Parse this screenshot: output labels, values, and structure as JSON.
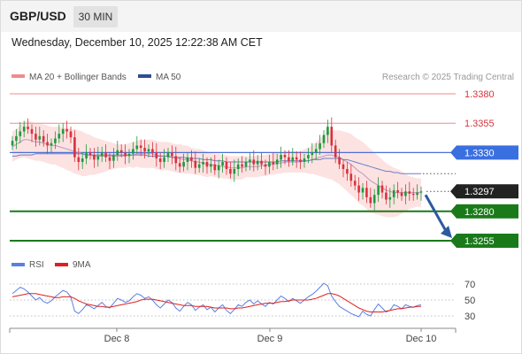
{
  "header": {
    "symbol": "GBP/USD",
    "timeframe": "30 MIN",
    "datetime": "Wednesday, December 10, 2025 12:22:38 AM CET"
  },
  "legend": {
    "ma20_label": "MA 20 + Bollinger Bands",
    "ma50_label": "MA 50",
    "source": "Research © 2025 Trading Central"
  },
  "colors": {
    "up": "#1e9a3c",
    "down": "#d8323c",
    "resistance": "#f08b8b",
    "support": "#1a7a1a",
    "ma50": "#4a6fd6",
    "ma20": "#c9a0c0",
    "band_fill": "#fde2e2",
    "arrow": "#2c5aa0",
    "rsi": "#5b7fe0",
    "rsi_ma": "#e02020"
  },
  "chart_data": [
    {
      "type": "candlestick",
      "levels": [
        {
          "value": "1.3380",
          "kind": "resistance"
        },
        {
          "value": "1.3355",
          "kind": "resistance"
        },
        {
          "value": "1.3330",
          "kind": "pivot"
        },
        {
          "value": "1.3297",
          "kind": "last"
        },
        {
          "value": "1.3280",
          "kind": "support"
        },
        {
          "value": "1.3255",
          "kind": "support"
        }
      ],
      "ylim": [
        1.3245,
        1.3392
      ],
      "xlabels": [
        "Dec 8",
        "Dec 9",
        "Dec 10"
      ],
      "series": [
        {
          "name": "MA 20 + Bollinger Bands"
        },
        {
          "name": "MA 50"
        }
      ],
      "close": [
        1.334,
        1.3344,
        1.3348,
        1.3352,
        1.335,
        1.3346,
        1.3341,
        1.3344,
        1.3339,
        1.3336,
        1.3338,
        1.3342,
        1.3346,
        1.335,
        1.3348,
        1.3343,
        1.3326,
        1.3322,
        1.3325,
        1.333,
        1.3328,
        1.3324,
        1.3327,
        1.333,
        1.3326,
        1.3323,
        1.3328,
        1.3332,
        1.333,
        1.3327,
        1.3329,
        1.3333,
        1.3336,
        1.3334,
        1.3331,
        1.3333,
        1.333,
        1.3325,
        1.3322,
        1.3326,
        1.333,
        1.3327,
        1.3321,
        1.3318,
        1.3322,
        1.3326,
        1.3323,
        1.3317,
        1.332,
        1.3322,
        1.3318,
        1.332,
        1.3315,
        1.3319,
        1.3322,
        1.3316,
        1.3312,
        1.3316,
        1.332,
        1.3318,
        1.3322,
        1.3324,
        1.332,
        1.3323,
        1.332,
        1.3318,
        1.3322,
        1.332,
        1.3324,
        1.3328,
        1.3326,
        1.3323,
        1.3326,
        1.3324,
        1.3322,
        1.3325,
        1.3328,
        1.333,
        1.3333,
        1.3338,
        1.3345,
        1.3352,
        1.3336,
        1.3326,
        1.332,
        1.3316,
        1.3312,
        1.3306,
        1.3302,
        1.3296,
        1.33,
        1.3292,
        1.3287,
        1.3294,
        1.3302,
        1.3296,
        1.329,
        1.3292,
        1.3298,
        1.3296,
        1.3293,
        1.3297,
        1.3295,
        1.3294,
        1.3296,
        1.3297
      ],
      "ma20": [
        1.3335,
        1.3337,
        1.3339,
        1.3341,
        1.3341,
        1.334,
        1.3339,
        1.3339,
        1.3338,
        1.3337,
        1.3336,
        1.3336,
        1.3335,
        1.3334,
        1.3333,
        1.3332,
        1.3331,
        1.333,
        1.3329,
        1.3328,
        1.3328,
        1.3327,
        1.3327,
        1.3327,
        1.3327,
        1.3327,
        1.3327,
        1.3327,
        1.3327,
        1.3327,
        1.3328,
        1.3328,
        1.3329,
        1.3329,
        1.3329,
        1.3329,
        1.3329,
        1.3328,
        1.3327,
        1.3327,
        1.3327,
        1.3326,
        1.3325,
        1.3325,
        1.3324,
        1.3324,
        1.3323,
        1.3322,
        1.3322,
        1.3321,
        1.332,
        1.332,
        1.3319,
        1.3319,
        1.3318,
        1.3318,
        1.3317,
        1.3317,
        1.3317,
        1.3317,
        1.3318,
        1.3318,
        1.3318,
        1.3318,
        1.3319,
        1.3319,
        1.332,
        1.332,
        1.3321,
        1.3321,
        1.3322,
        1.3322,
        1.3322,
        1.3322,
        1.3322,
        1.3323,
        1.3323,
        1.3324,
        1.3325,
        1.3326,
        1.3327,
        1.3328,
        1.3328,
        1.3327,
        1.3326,
        1.3324,
        1.3322,
        1.332,
        1.3317,
        1.3314,
        1.3312,
        1.3309,
        1.3306,
        1.3304,
        1.3302,
        1.33,
        1.3298,
        1.3297,
        1.3296,
        1.3296,
        1.3296,
        1.3296,
        1.3296,
        1.3296,
        1.3296,
        1.3296
      ],
      "ma50": [
        1.3327,
        1.3327,
        1.3328,
        1.3328,
        1.3328,
        1.3328,
        1.3329,
        1.3329,
        1.3329,
        1.3329,
        1.3329,
        1.3329,
        1.3329,
        1.3329,
        1.3329,
        1.3329,
        1.3329,
        1.3329,
        1.3329,
        1.3328,
        1.3328,
        1.3328,
        1.3328,
        1.3328,
        1.3328,
        1.3328,
        1.3328,
        1.3328,
        1.3328,
        1.3328,
        1.3328,
        1.3328,
        1.3328,
        1.3328,
        1.3328,
        1.3327,
        1.3327,
        1.3327,
        1.3327,
        1.3327,
        1.3327,
        1.3326,
        1.3326,
        1.3326,
        1.3326,
        1.3325,
        1.3325,
        1.3325,
        1.3325,
        1.3324,
        1.3324,
        1.3324,
        1.3323,
        1.3323,
        1.3323,
        1.3322,
        1.3322,
        1.3322,
        1.3322,
        1.3322,
        1.3322,
        1.3322,
        1.3322,
        1.3322,
        1.3322,
        1.3322,
        1.3322,
        1.3322,
        1.3322,
        1.3323,
        1.3323,
        1.3323,
        1.3323,
        1.3323,
        1.3323,
        1.3323,
        1.3323,
        1.3324,
        1.3324,
        1.3324,
        1.3325,
        1.3325,
        1.3325,
        1.3325,
        1.3325,
        1.3324,
        1.3324,
        1.3323,
        1.3322,
        1.3321,
        1.332,
        1.3319,
        1.3318,
        1.3317,
        1.3316,
        1.3315,
        1.3314,
        1.3314,
        1.3313,
        1.3313,
        1.3312,
        1.3312,
        1.3312,
        1.3312,
        1.3312,
        1.3312
      ],
      "band_width": [
        0.0013,
        0.0013,
        0.0014,
        0.0015,
        0.0016,
        0.0016,
        0.0016,
        0.0016,
        0.0016,
        0.0016,
        0.0016,
        0.0016,
        0.0017,
        0.0017,
        0.0018,
        0.0018,
        0.0019,
        0.0019,
        0.0019,
        0.0018,
        0.0017,
        0.0016,
        0.0015,
        0.0014,
        0.0013,
        0.0012,
        0.0011,
        0.001,
        0.001,
        0.001,
        0.001,
        0.0011,
        0.0011,
        0.0012,
        0.0012,
        0.0012,
        0.0012,
        0.0012,
        0.0012,
        0.0012,
        0.0012,
        0.0012,
        0.0012,
        0.0012,
        0.0012,
        0.0012,
        0.0011,
        0.0011,
        0.0011,
        0.0011,
        0.0011,
        0.001,
        0.001,
        0.001,
        0.001,
        0.001,
        0.001,
        0.001,
        0.001,
        0.001,
        0.0009,
        0.0009,
        0.0009,
        0.0009,
        0.0009,
        0.0009,
        0.0009,
        0.0009,
        0.0009,
        0.0009,
        0.0009,
        0.0009,
        0.0009,
        0.0009,
        0.0009,
        0.001,
        0.0011,
        0.0012,
        0.0014,
        0.0016,
        0.0018,
        0.002,
        0.0021,
        0.0022,
        0.0023,
        0.0024,
        0.0025,
        0.0026,
        0.0026,
        0.0027,
        0.0027,
        0.0027,
        0.0027,
        0.0026,
        0.0025,
        0.0024,
        0.0023,
        0.0022,
        0.0021,
        0.002,
        0.0018,
        0.0016,
        0.0014,
        0.0013,
        0.0012,
        0.0012
      ]
    },
    {
      "type": "line",
      "series": [
        {
          "name": "RSI",
          "values": [
            58,
            62,
            66,
            64,
            60,
            55,
            50,
            53,
            48,
            46,
            49,
            54,
            58,
            62,
            60,
            54,
            36,
            33,
            38,
            44,
            42,
            39,
            43,
            47,
            42,
            40,
            46,
            52,
            50,
            47,
            49,
            54,
            58,
            56,
            52,
            54,
            50,
            44,
            40,
            45,
            50,
            47,
            40,
            36,
            42,
            47,
            44,
            37,
            41,
            44,
            38,
            41,
            35,
            40,
            44,
            37,
            33,
            38,
            44,
            42,
            47,
            50,
            45,
            49,
            45,
            42,
            47,
            45,
            50,
            55,
            52,
            48,
            52,
            49,
            46,
            50,
            54,
            57,
            61,
            66,
            71,
            68,
            55,
            48,
            42,
            39,
            36,
            33,
            31,
            29,
            36,
            32,
            30,
            38,
            45,
            40,
            35,
            37,
            44,
            42,
            39,
            44,
            42,
            41,
            43,
            44
          ]
        },
        {
          "name": "9MA",
          "values": [
            54,
            55,
            56,
            57,
            58,
            58,
            58,
            57,
            56,
            55,
            54,
            53,
            53,
            54,
            54,
            54,
            52,
            49,
            47,
            45,
            44,
            43,
            42,
            42,
            41,
            41,
            42,
            43,
            44,
            45,
            46,
            47,
            48,
            50,
            51,
            51,
            51,
            50,
            49,
            48,
            47,
            46,
            45,
            44,
            43,
            43,
            43,
            42,
            42,
            42,
            42,
            41,
            40,
            40,
            40,
            40,
            39,
            39,
            40,
            40,
            41,
            42,
            43,
            44,
            45,
            46,
            46,
            46,
            47,
            48,
            48,
            49,
            50,
            50,
            50,
            50,
            50,
            51,
            52,
            54,
            56,
            58,
            58,
            57,
            55,
            52,
            49,
            46,
            43,
            40,
            38,
            36,
            35,
            35,
            35,
            35,
            36,
            37,
            38,
            39,
            39,
            40,
            41,
            41,
            42,
            42
          ]
        }
      ],
      "ylim": [
        20,
        80
      ],
      "yticks": [
        70,
        50,
        30
      ]
    }
  ]
}
